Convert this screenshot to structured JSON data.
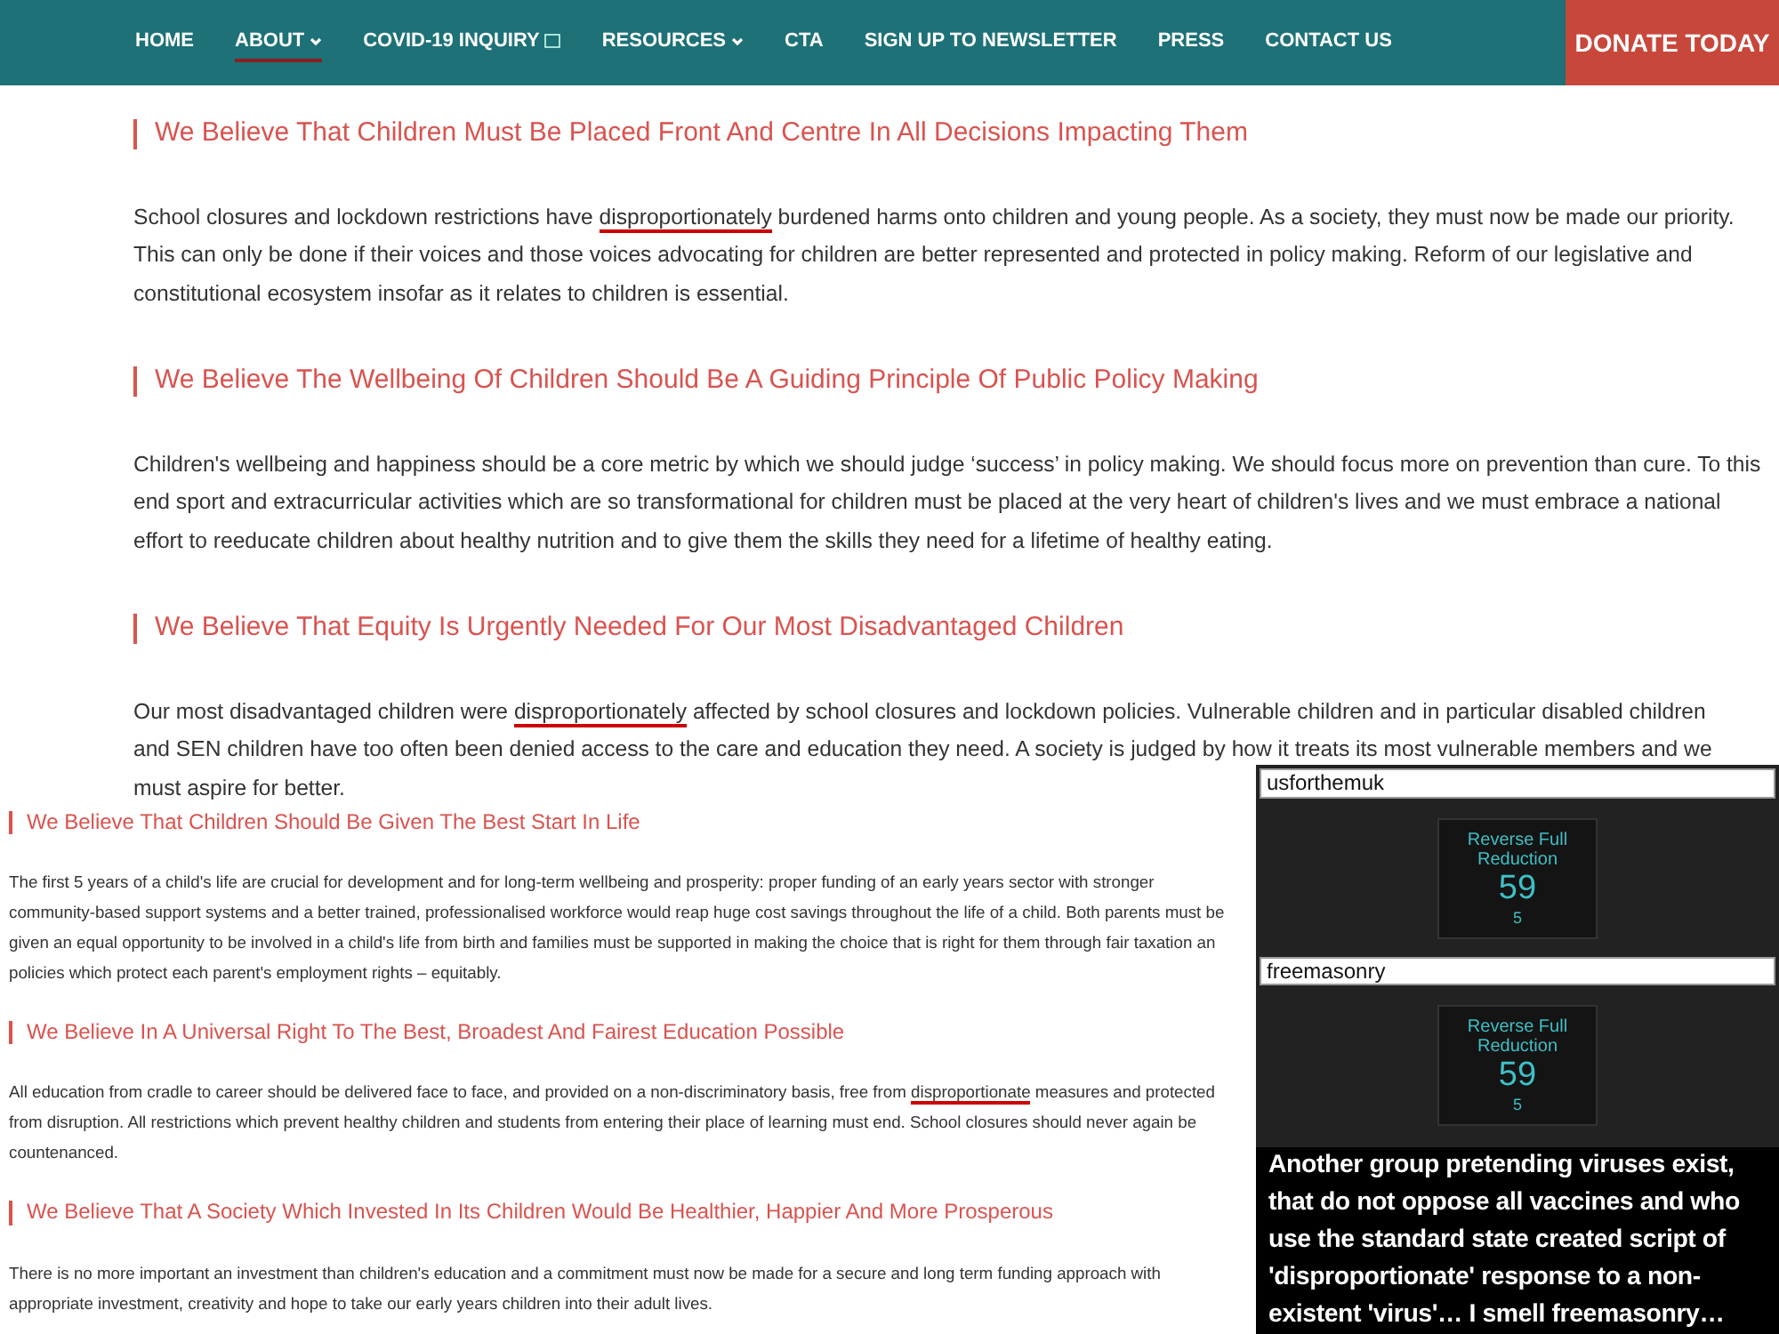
{
  "nav": {
    "items": [
      {
        "label": "HOME",
        "selected": false,
        "has_menu": false,
        "trailing_glyph": false
      },
      {
        "label": "ABOUT",
        "selected": true,
        "has_menu": true,
        "trailing_glyph": false
      },
      {
        "label": "COVID-19 INQUIRY",
        "selected": false,
        "has_menu": false,
        "trailing_glyph": true
      },
      {
        "label": "RESOURCES",
        "selected": false,
        "has_menu": true,
        "trailing_glyph": false
      },
      {
        "label": "CTA",
        "selected": false,
        "has_menu": false,
        "trailing_glyph": false
      },
      {
        "label": "SIGN UP TO NEWSLETTER",
        "selected": false,
        "has_menu": false,
        "trailing_glyph": false
      },
      {
        "label": "PRESS",
        "selected": false,
        "has_menu": false,
        "trailing_glyph": false
      },
      {
        "label": "CONTACT US",
        "selected": false,
        "has_menu": false,
        "trailing_glyph": false
      }
    ],
    "donate": "DONATE TODAY"
  },
  "upper_sections": [
    {
      "heading": "We Believe That Children Must Be Placed Front And Centre In All Decisions Impacting Them",
      "lines": [
        [
          {
            "text": "School closures and lockdown restrictions have ",
            "underlined": false
          },
          {
            "text": "disproportionately",
            "underlined": true
          },
          {
            "text": " burdened harms onto children and young people. As a society, they must now be made our priority.",
            "underlined": false
          }
        ],
        [
          {
            "text": "This can only be done if their voices and those voices advocating for children are better represented and protected in policy making. Reform of our legislative and",
            "underlined": false
          }
        ],
        [
          {
            "text": "constitutional ecosystem insofar as it relates to children is essential.",
            "underlined": false
          }
        ]
      ]
    },
    {
      "heading": "We Believe The Wellbeing Of Children Should Be A Guiding Principle Of Public Policy Making",
      "lines": [
        [
          {
            "text": "Children's wellbeing and happiness should be a core metric by which we should judge ‘success’ in policy making. We should focus more on prevention than cure. To this",
            "underlined": false
          }
        ],
        [
          {
            "text": "end sport and extracurricular activities which are so transformational for children must be placed at the very heart of children's lives and we must embrace a national",
            "underlined": false
          }
        ],
        [
          {
            "text": "effort to reeducate children about healthy nutrition and to give them the skills they need for a lifetime of healthy eating.",
            "underlined": false
          }
        ]
      ]
    },
    {
      "heading": "We Believe That Equity Is Urgently Needed For Our Most Disadvantaged Children",
      "lines": [
        [
          {
            "text": "Our most disadvantaged children were ",
            "underlined": false
          },
          {
            "text": "disproportionately",
            "underlined": true
          },
          {
            "text": " affected by school closures and lockdown policies. Vulnerable children and in particular disabled children",
            "underlined": false
          }
        ],
        [
          {
            "text": "and SEN children have too often been denied access to the care and education they need. A society is judged by how it treats its most vulnerable members and we",
            "underlined": false
          }
        ],
        [
          {
            "text": "must aspire for better.",
            "underlined": false
          }
        ]
      ]
    }
  ],
  "lower_sections": [
    {
      "heading": "We Believe That Children Should Be Given The Best Start In Life",
      "lines": [
        [
          {
            "text": "The first 5 years of a child's life are crucial for development and for long-term wellbeing and prosperity: proper funding of an early years sector with stronger",
            "underlined": false
          }
        ],
        [
          {
            "text": "community-based support systems and a better trained, professionalised workforce would reap huge cost savings throughout the life of a child. Both parents must be",
            "underlined": false
          }
        ],
        [
          {
            "text": "given an equal opportunity to be involved in a child's life from birth and families must be supported in making the choice that is right for them through fair taxation an",
            "underlined": false
          }
        ],
        [
          {
            "text": "policies which protect each parent's employment rights – equitably.",
            "underlined": false
          }
        ]
      ]
    },
    {
      "heading": "We Believe In A Universal Right To The Best, Broadest And Fairest Education Possible",
      "lines": [
        [
          {
            "text": "All education from cradle to career should be delivered face to face, and provided on a non-discriminatory basis, free from ",
            "underlined": false
          },
          {
            "text": "disproportionate",
            "underlined": true
          },
          {
            "text": " measures and protected",
            "underlined": false
          }
        ],
        [
          {
            "text": "from disruption. All restrictions which prevent healthy children and students from entering their place of learning must end. School closures should never again be",
            "underlined": false
          }
        ],
        [
          {
            "text": "countenanced.",
            "underlined": false
          }
        ]
      ]
    },
    {
      "heading": "We Believe That A Society Which Invested In Its Children Would Be Healthier, Happier And More Prosperous",
      "lines": [
        [
          {
            "text": "There is no more important an investment than children's education and a commitment must now be made for a secure and long term funding approach with",
            "underlined": false
          }
        ],
        [
          {
            "text": "appropriate investment, creativity and hope to take our early years children into their adult lives.",
            "underlined": false
          }
        ]
      ]
    }
  ],
  "search_panel": {
    "results": [
      {
        "query": "usforthemuk",
        "card_title": "Reverse Full Reduction",
        "score": "59",
        "sub": "5"
      },
      {
        "query": "freemasonry",
        "card_title": "Reverse Full Reduction",
        "score": "59",
        "sub": "5"
      }
    ]
  },
  "caption": "Another group pretending viruses exist, that do not oppose all vaccines and who use the standard state created script of 'disproportionate' response to a non-existent 'virus'… I smell freemasonry…"
}
